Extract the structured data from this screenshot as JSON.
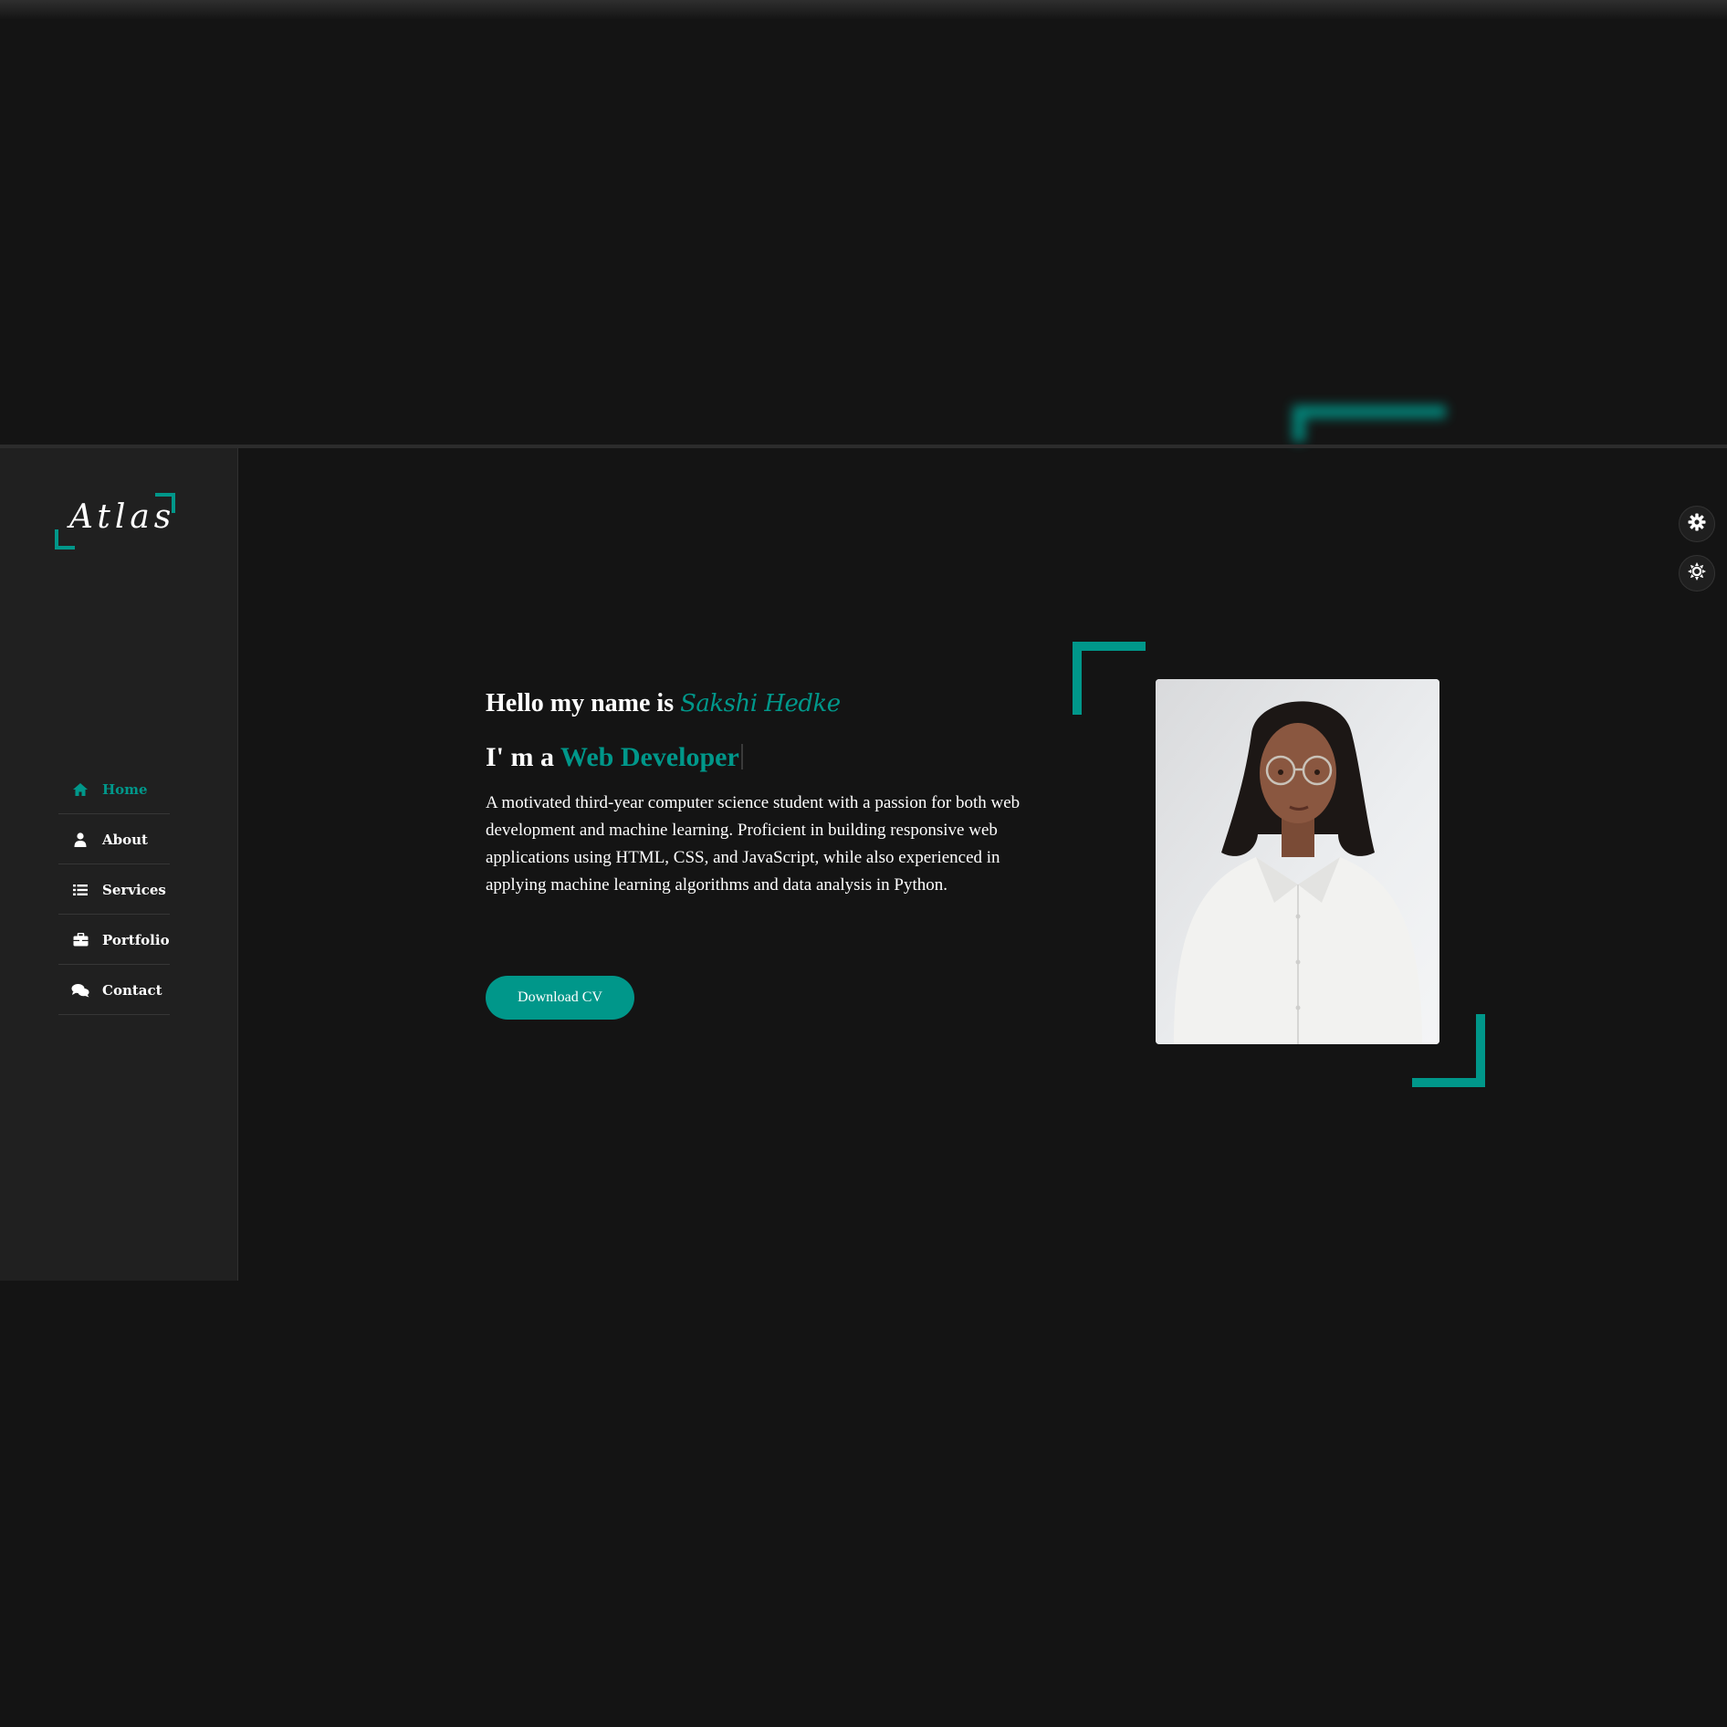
{
  "logo": {
    "text": "Atlas"
  },
  "nav": {
    "items": [
      {
        "label": "Home",
        "icon": "home-icon",
        "active": true
      },
      {
        "label": "About",
        "icon": "user-icon",
        "active": false
      },
      {
        "label": "Services",
        "icon": "list-icon",
        "active": false
      },
      {
        "label": "Portfolio",
        "icon": "briefcase-icon",
        "active": false
      },
      {
        "label": "Contact",
        "icon": "comments-icon",
        "active": false
      }
    ]
  },
  "hero": {
    "greeting": "Hello my name is",
    "name": "Sakshi Hedke",
    "role_prefix": "I' m a",
    "role": "Web Developer",
    "description": "A motivated third-year computer science student with a passion for both web development and machine learning. Proficient in building responsive web applications using HTML, CSS, and JavaScript, while also experienced in applying machine learning algorithms and data analysis in Python.",
    "button_label": "Download CV"
  },
  "side_controls": {
    "settings_icon": "gear-icon",
    "theme_icon": "sun-icon"
  },
  "colors": {
    "accent": "#00978a",
    "background": "#141414",
    "sidebar": "#202020",
    "text": "#ffffff"
  }
}
